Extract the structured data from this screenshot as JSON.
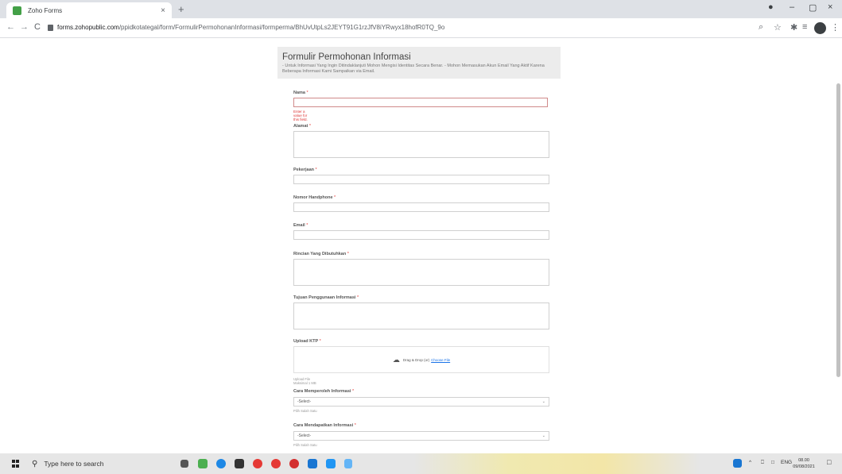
{
  "browser": {
    "tab_title": "Zoho Forms",
    "tab_close": "×",
    "new_tab": "+",
    "url_host": "forms.zohopublic.com",
    "url_path": "/ppidkotategal/form/FormulirPermohonanInformasi/formperma/BhUvUtpLs2JEYT91G1rzJfV8iYRwyx18hofR0TQ_9o",
    "back": "←",
    "forward": "→",
    "reload": "C",
    "zoom_icon": "⌕",
    "star_icon": "☆",
    "extensions_icon": "✱",
    "reading_list_icon": "≡",
    "menu_icon": "⋮",
    "window_minimize": "–",
    "window_restore": "▢",
    "window_close": "×",
    "record_icon": "●"
  },
  "form": {
    "title": "Formulir Permohonan Informasi",
    "description": "- Untuk Informasi Yang Ingin Ditindaklanjuti Mohon Mengisi Identitas Secara Benar. - Mohon Memasukan Akun Email Yang Aktif Karena Beberapa Informasi Kami Sampaikan via Email.",
    "required_mark": "*",
    "fields": {
      "nama": {
        "label": "Nama",
        "error": "Enter a value for this field."
      },
      "alamat": {
        "label": "Alamat"
      },
      "pekerjaan": {
        "label": "Pekerjaan"
      },
      "nomor_handphone": {
        "label": "Nomor Handphone"
      },
      "email": {
        "label": "Email"
      },
      "rincian": {
        "label": "Rincian Yang Dibutuhkan"
      },
      "tujuan": {
        "label": "Tujuan Penggunaan Informasi"
      },
      "upload_ktp": {
        "label": "Upload KTP",
        "drop_text": "Drag & Drop (or)",
        "choose_file": "Choose File",
        "hint": "Upload File Maksimal 1 MB"
      },
      "cara_memperoleh": {
        "label": "Cara Memperoleh Informasi",
        "value": "-Select-",
        "hint": "Pilih Salah Satu"
      },
      "cara_mendapatkan": {
        "label": "Cara Mendapatkan Informasi",
        "value": "-Select-",
        "hint": "Pilih Salah Satu"
      }
    }
  },
  "taskbar": {
    "search_placeholder": "Type here to search",
    "language": "ENG",
    "time": "08.00",
    "date": "09/08/2021",
    "chevron_up": "^"
  },
  "colors": {
    "accent_link": "#1a73e8",
    "required": "#e53935",
    "header_bg": "#ececec"
  }
}
